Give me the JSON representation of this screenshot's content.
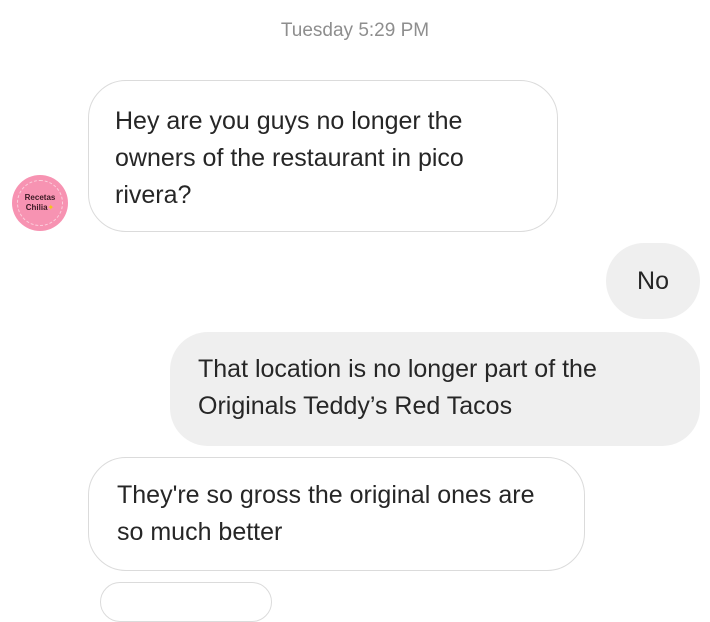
{
  "conversation": {
    "timestamp": "Tuesday 5:29 PM",
    "avatar": {
      "text_line1": "Recetas",
      "text_line2": "Chilia",
      "color": "#f793b2"
    },
    "messages": [
      {
        "sender": "them",
        "text": "Hey are you guys no longer the owners of the restaurant in pico rivera?"
      },
      {
        "sender": "me",
        "text": "No"
      },
      {
        "sender": "me",
        "text": "That location is no longer part of the Originals Teddy’s Red Tacos"
      },
      {
        "sender": "them",
        "text": "They're so gross the original ones are so much better"
      }
    ]
  },
  "colors": {
    "incoming_bubble_border": "#dbdbdb",
    "outgoing_bubble_bg": "#efefef",
    "timestamp_text": "#8e8e8e",
    "message_text": "#262626"
  }
}
